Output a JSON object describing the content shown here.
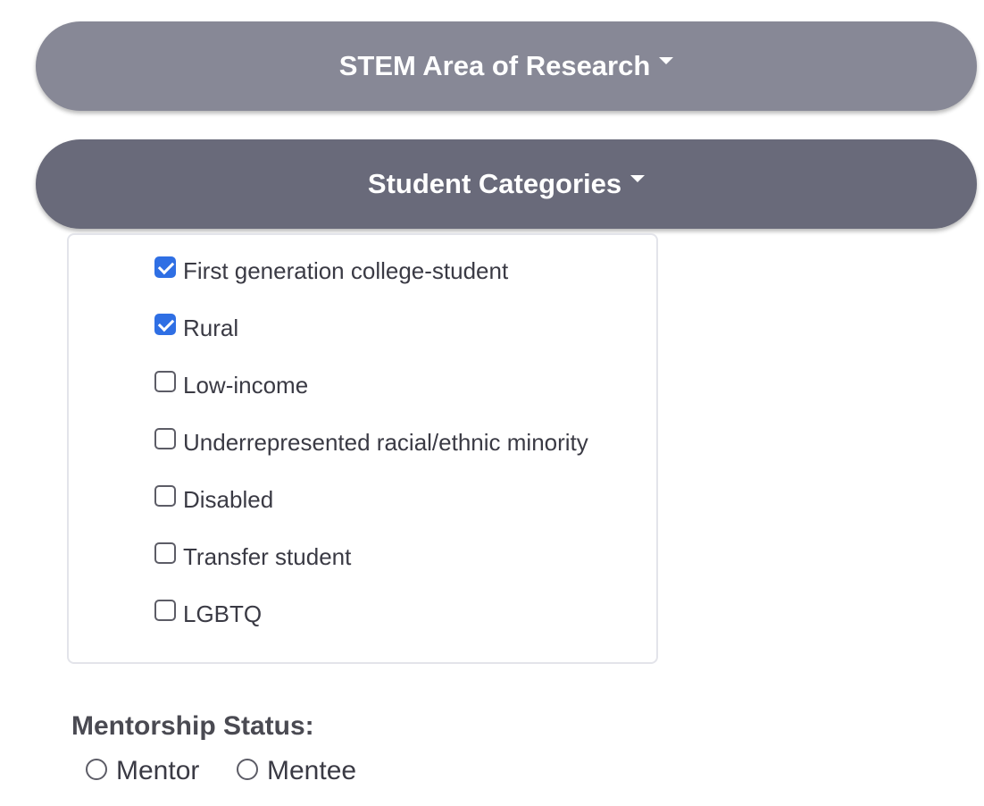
{
  "research_toggle": {
    "label": "STEM Area of Research"
  },
  "categories_toggle": {
    "label": "Student Categories"
  },
  "categories": {
    "options": [
      {
        "label": "First generation college-student",
        "checked": true
      },
      {
        "label": "Rural",
        "checked": true
      },
      {
        "label": "Low-income",
        "checked": false
      },
      {
        "label": "Underrepresented racial/ethnic minority",
        "checked": false
      },
      {
        "label": "Disabled",
        "checked": false
      },
      {
        "label": "Transfer student",
        "checked": false
      },
      {
        "label": "LGBTQ",
        "checked": false
      }
    ]
  },
  "mentorship": {
    "label": "Mentorship Status:",
    "options": [
      {
        "label": "Mentor",
        "selected": false
      },
      {
        "label": "Mentee",
        "selected": false
      }
    ]
  },
  "colors": {
    "pill_light": "#878896",
    "pill_dark": "#696a7a",
    "checkbox_accent": "#2f6fe4"
  }
}
